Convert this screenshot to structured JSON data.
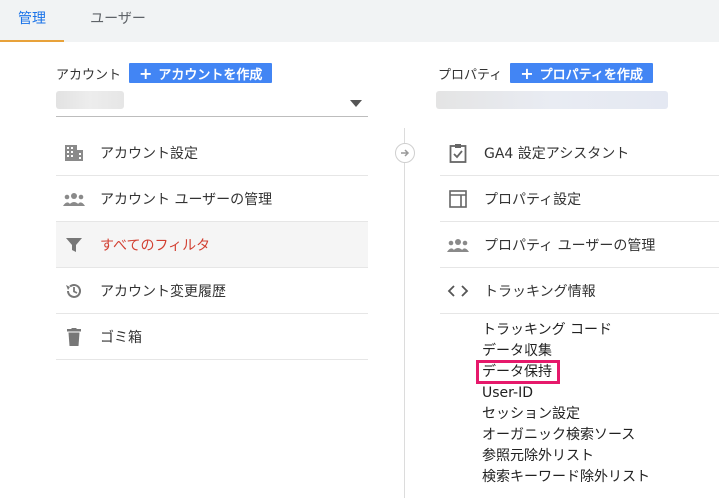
{
  "tabs": [
    {
      "label": "管理"
    },
    {
      "label": "ユーザー"
    }
  ],
  "account": {
    "heading": "アカウント",
    "create_label": "アカウントを作成",
    "items": [
      {
        "label": "アカウント設定",
        "icon": "building-icon"
      },
      {
        "label": "アカウント ユーザーの管理",
        "icon": "people-icon"
      },
      {
        "label": "すべてのフィルタ",
        "icon": "filter-icon"
      },
      {
        "label": "アカウント変更履歴",
        "icon": "history-icon"
      },
      {
        "label": "ゴミ箱",
        "icon": "trash-icon"
      }
    ]
  },
  "property": {
    "heading": "プロパティ",
    "create_label": "プロパティを作成",
    "items": [
      {
        "label": "GA4 設定アシスタント",
        "icon": "clipboard-check-icon"
      },
      {
        "label": "プロパティ設定",
        "icon": "layout-icon"
      },
      {
        "label": "プロパティ ユーザーの管理",
        "icon": "people-icon"
      },
      {
        "label": "トラッキング情報",
        "icon": "code-icon"
      }
    ],
    "tracking_sub": [
      "トラッキング コード",
      "データ収集",
      "データ保持",
      "User-ID",
      "セッション設定",
      "オーガニック検索ソース",
      "参照元除外リスト",
      "検索キーワード除外リスト"
    ]
  },
  "colors": {
    "accent": "#4285f4",
    "active_filter": "#d23f31",
    "highlight": "#e6196b",
    "tab_underline": "#e8a23a"
  }
}
